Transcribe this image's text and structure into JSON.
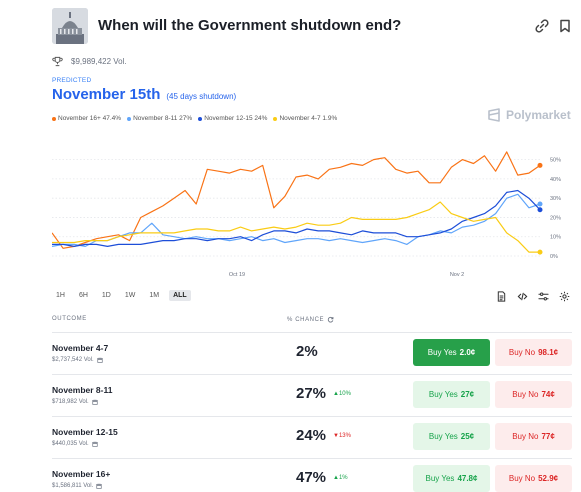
{
  "header": {
    "title": "When will the Government shutdown end?"
  },
  "volume": "$9,989,422 Vol.",
  "prediction": {
    "label": "PREDICTED",
    "value": "November 15th",
    "sub": "(45 days shutdown)"
  },
  "legend": [
    {
      "label": "November 16+ 47.4%",
      "color": "#f97316"
    },
    {
      "label": "November 8-11 27%",
      "color": "#60a5fa"
    },
    {
      "label": "November 12-15 24%",
      "color": "#1d4ed8"
    },
    {
      "label": "November 4-7 1.9%",
      "color": "#facc15"
    }
  ],
  "brand": "Polymarket",
  "chart_data": {
    "type": "line",
    "x_ticks": [
      "Oct 19",
      "Nov 2"
    ],
    "y_ticks": [
      "50%",
      "40%",
      "30%",
      "20%",
      "10%",
      "0%"
    ],
    "ylim": [
      0,
      55
    ],
    "grid": true,
    "series": [
      {
        "name": "November 16+",
        "color": "#f97316",
        "values": [
          12,
          4,
          5,
          7,
          9,
          10,
          11,
          8,
          20,
          23,
          26,
          30,
          34,
          27,
          45,
          44,
          43,
          45,
          44,
          47,
          25,
          31,
          41,
          42,
          40,
          45,
          46,
          48,
          47,
          50,
          51,
          45,
          43,
          44,
          38,
          38,
          46,
          50,
          48,
          52,
          44,
          54,
          42,
          43,
          47
        ]
      },
      {
        "name": "November 8-11",
        "color": "#60a5fa",
        "values": [
          5,
          6,
          6,
          5,
          8,
          8,
          10,
          12,
          12,
          17,
          11,
          10,
          9,
          10,
          9,
          9,
          8,
          9,
          10,
          8,
          9,
          7,
          8,
          9,
          9,
          8,
          9,
          8,
          7,
          8,
          9,
          8,
          6,
          10,
          11,
          13,
          12,
          15,
          16,
          18,
          22,
          30,
          32,
          25,
          27
        ]
      },
      {
        "name": "November 12-15",
        "color": "#1d4ed8",
        "values": [
          6,
          6,
          5,
          6,
          6,
          5,
          6,
          6,
          6,
          7,
          8,
          8,
          9,
          9,
          8,
          9,
          9,
          10,
          8,
          11,
          13,
          13,
          12,
          14,
          13,
          13,
          12,
          11,
          13,
          12,
          12,
          12,
          10,
          10,
          11,
          12,
          14,
          18,
          20,
          22,
          26,
          33,
          34,
          30,
          24
        ]
      },
      {
        "name": "November 4-7",
        "color": "#facc15",
        "values": [
          7,
          7,
          7,
          8,
          8,
          8,
          10,
          11,
          12,
          12,
          12,
          12,
          13,
          14,
          14,
          13,
          13,
          15,
          13,
          14,
          15,
          14,
          15,
          17,
          16,
          16,
          17,
          20,
          19,
          19,
          19,
          19,
          20,
          22,
          24,
          28,
          22,
          20,
          18,
          19,
          20,
          12,
          8,
          2,
          2
        ]
      }
    ]
  },
  "range_tabs": [
    "1H",
    "6H",
    "1D",
    "1W",
    "1M",
    "ALL"
  ],
  "columns": {
    "outcome": "OUTCOME",
    "chance": "% CHANCE"
  },
  "outcomes": [
    {
      "name": "November 4-7",
      "vol": "$2,737,542 Vol.",
      "chance": "2%",
      "change": "",
      "yes_label": "Buy Yes",
      "yes_price": "2.0¢",
      "no_label": "Buy No",
      "no_price": "98.1¢"
    },
    {
      "name": "November 8-11",
      "vol": "$718,982 Vol.",
      "chance": "27%",
      "change": "▲10%",
      "yes_label": "Buy Yes",
      "yes_price": "27¢",
      "no_label": "Buy No",
      "no_price": "74¢"
    },
    {
      "name": "November 12-15",
      "vol": "$440,035 Vol.",
      "chance": "24%",
      "change": "▼13%",
      "yes_label": "Buy Yes",
      "yes_price": "25¢",
      "no_label": "Buy No",
      "no_price": "77¢"
    },
    {
      "name": "November 16+",
      "vol": "$1,586,811 Vol.",
      "chance": "47%",
      "change": "▲1%",
      "yes_label": "Buy Yes",
      "yes_price": "47.8¢",
      "no_label": "Buy No",
      "no_price": "52.9¢"
    }
  ]
}
